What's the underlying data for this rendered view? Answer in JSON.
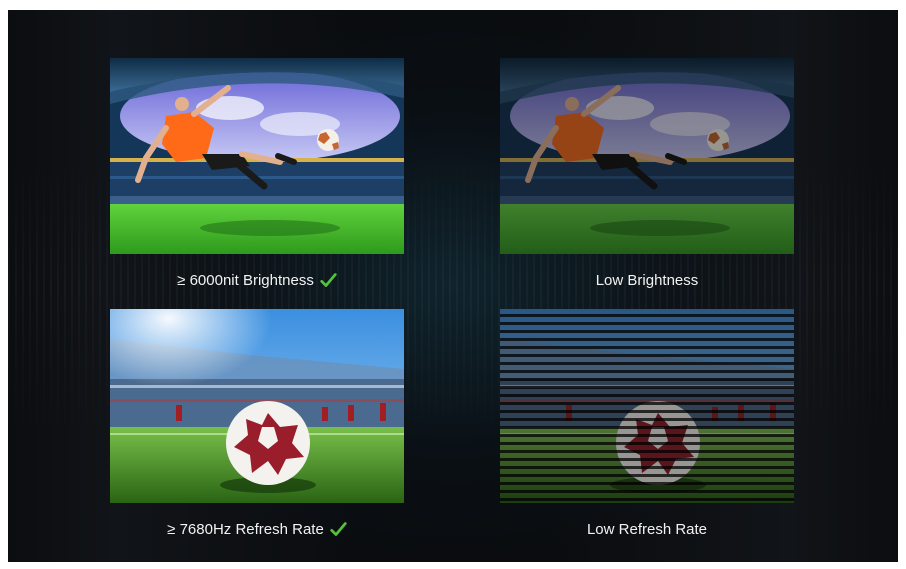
{
  "comparison": {
    "brightness": {
      "good_label": "≥ 6000nit Brightness",
      "bad_label": "Low Brightness"
    },
    "refresh": {
      "good_label": "≥ 7680Hz Refresh Rate",
      "bad_label": "Low Refresh Rate"
    }
  },
  "icons": {
    "good_marker": "check-icon"
  },
  "colors": {
    "check": "#56c23a",
    "background": "#0b0d10",
    "caption_text": "#f2f2f2"
  }
}
